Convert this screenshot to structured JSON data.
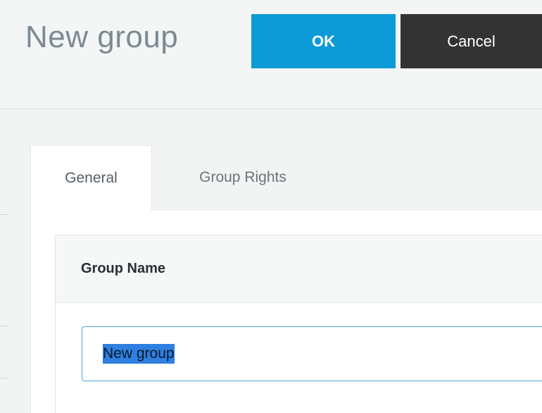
{
  "header": {
    "title": "New group",
    "ok_label": "OK",
    "cancel_label": "Cancel"
  },
  "tabs": [
    {
      "label": "General",
      "active": true
    },
    {
      "label": "Group Rights",
      "active": false
    }
  ],
  "general": {
    "section_title": "Group Name",
    "group_name_value": "New group"
  },
  "colors": {
    "primary": "#0c9ad6",
    "cancel": "#333333",
    "selection": "#2e7fe0"
  }
}
